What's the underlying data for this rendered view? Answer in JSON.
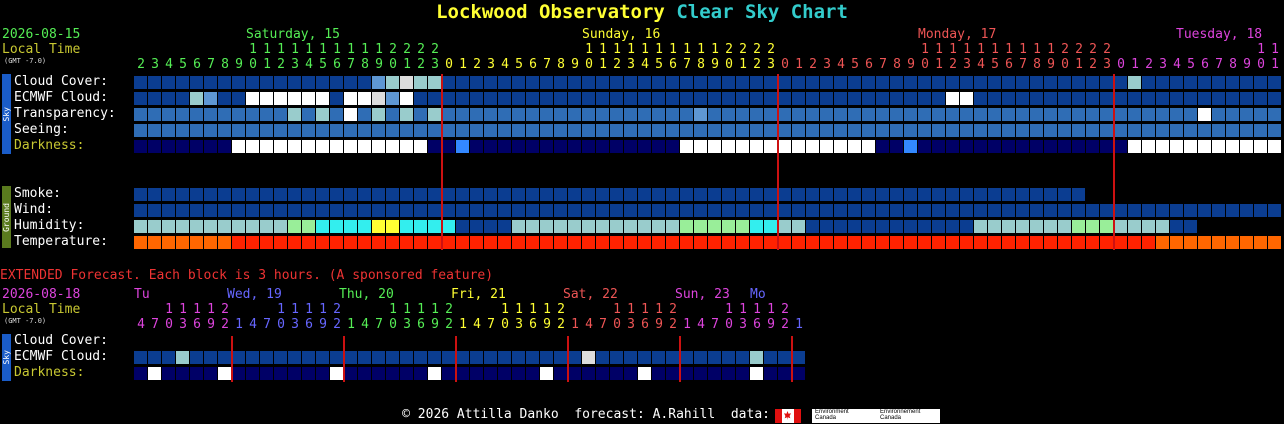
{
  "title": {
    "main": "Lockwood Observatory",
    "sub": "Clear Sky Chart"
  },
  "header": {
    "date": "2026-08-15",
    "local_time": "Local Time",
    "gmt": "(GMT -7.0)",
    "days": [
      {
        "label": "Saturday, 15",
        "color": "#55ee55"
      },
      {
        "label": "Sunday, 16",
        "color": "#ffff33"
      },
      {
        "label": "Monday, 17",
        "color": "#ee5555"
      },
      {
        "label": "Tuesday, 18",
        "color": "#dd44dd"
      }
    ],
    "hour_tens": "11111111111112222               1111111111112222               1111111111112222              11",
    "hour_ones": "2345678901234567890123012345678901234567890123012345678901234567890123012345678901"
  },
  "sections": {
    "sky": "Sky",
    "ground": "Ground",
    "ext_sky": "Sky"
  },
  "rows": [
    {
      "key": "cloud",
      "label": "Cloud Cover:"
    },
    {
      "key": "ecmwf",
      "label": "ECMWF Cloud:"
    },
    {
      "key": "transparency",
      "label": "Transparency:"
    },
    {
      "key": "seeing",
      "label": "Seeing:"
    },
    {
      "key": "darkness",
      "label": "Darkness:"
    },
    {
      "key": "smoke",
      "label": "Smoke:"
    },
    {
      "key": "wind",
      "label": "Wind:"
    },
    {
      "key": "humidity",
      "label": "Humidity:"
    },
    {
      "key": "temperature",
      "label": "Temperature:"
    }
  ],
  "extended": {
    "notice": "EXTENDED Forecast. Each block is 3 hours. (A sponsored feature)",
    "date": "2026-08-18",
    "local_time": "Local Time",
    "gmt": "(GMT -7.0)",
    "days": [
      {
        "label": "Tu",
        "color": "#dd44dd"
      },
      {
        "label": "Wed, 19",
        "color": "#6666ff"
      },
      {
        "label": "Thu, 20",
        "color": "#55ee55"
      },
      {
        "label": "Fri, 21",
        "color": "#ffff33"
      },
      {
        "label": "Sat, 22",
        "color": "#ee5555"
      },
      {
        "label": "Sun, 23",
        "color": "#dd44dd"
      },
      {
        "label": "Mo",
        "color": "#6666ff"
      }
    ],
    "rows": [
      {
        "key": "cloud",
        "label": "Cloud Cover:"
      },
      {
        "key": "ecmwf",
        "label": "ECMWF Cloud:"
      },
      {
        "key": "darkness",
        "label": "Darkness:"
      }
    ]
  },
  "footer": {
    "text": "© 2026 Attilla Danko  forecast: A.Rahill  data:",
    "agency_en": "Environment\nCanada",
    "agency_fr": "Environnement\nCanada"
  },
  "colors": {
    "clear": "#0b3d91",
    "mostly_clear": "#2f6db5",
    "partly": "#5e97d3",
    "cloudy": "#99cccc",
    "overcast": "#dddddd",
    "day_line": "#cc1111",
    "temperature_warm": "#ff6600",
    "temperature_hot": "#ff2200"
  },
  "chart_data": {
    "type": "heatmap",
    "title": "Lockwood Observatory Clear Sky Chart",
    "main_hours": [
      2,
      3,
      4,
      5,
      6,
      7,
      8,
      9,
      10,
      11,
      12,
      13,
      14,
      15,
      16,
      17,
      18,
      19,
      20,
      21,
      22,
      23,
      0,
      1,
      2,
      3,
      4,
      5,
      6,
      7,
      8,
      9,
      10,
      11,
      12,
      13,
      14,
      15,
      16,
      17,
      18,
      19,
      20,
      21,
      22,
      23,
      0,
      1,
      2,
      3,
      4,
      5,
      6,
      7,
      8,
      9,
      10,
      11,
      12,
      13,
      14,
      15,
      16,
      17,
      18,
      19,
      20,
      21,
      22,
      23,
      0,
      1,
      2,
      3,
      4,
      5,
      6,
      7,
      8,
      9,
      10,
      11
    ],
    "cloud_cover": "000000000000000002343300000000000000000000000000000000000000000000000003000000000000000002211222000000",
    "ecmwf_cloud": "00003200555555055425000000000000000000000000000000000000005500000000000000000000000000000033333000000",
    "transparency": "00000000000202050404020000000000000000001000000000000000000000000000000000005000000000005050000000",
    "seeing": "11111111111111111111111111111111111111111111111111111111111111111111111111111111111",
    "darkness": "ddddddd00000000000000dd5ddddddddddddddd00000000000000dd5ddddddddddddddd00000000000000ddddddddd000000",
    "smoke": "00000000000000000000000000000000000000000000000000000000000000000000",
    "wind": "0000000000000000000000000000000000000000000000000000000000000000000000000000000000000",
    "humidity": "2222222222233444455444400002222222222223333344220000000000002222222333222200",
    "temperature": "aaaaaaabbbbbbbbbbbbbbbbbbbbbbbbbbbbbbbbbbbbbbbbbbbbbbbbbbbbbbbbbbbbbbbbbbaaaaaaaaaaaaa",
    "extended_hours": [
      4,
      7,
      10,
      13,
      16,
      19,
      22,
      1,
      4,
      7,
      10,
      13,
      16,
      19,
      22,
      1,
      4,
      7,
      10,
      13,
      16,
      19,
      22,
      1,
      4,
      7,
      10,
      13,
      16,
      19,
      22,
      1,
      4,
      7,
      10,
      13,
      16,
      19,
      22,
      1,
      4,
      7,
      10,
      13,
      16,
      19,
      22,
      1
    ],
    "extended_cloud": "00030000000000000000000000000000400000000000300000",
    "extended_darkness": "d0dddd0ddddddd0dddddd0ddddddd0dddddd0ddddddd0dddd"
  }
}
